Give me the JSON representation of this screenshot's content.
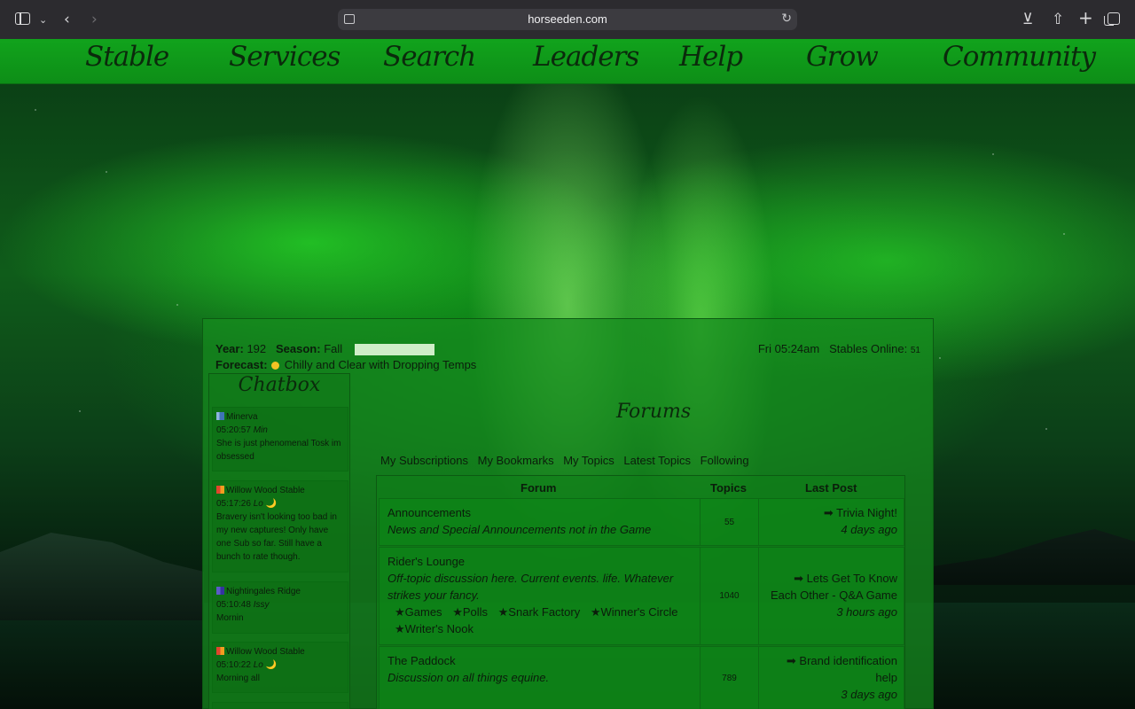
{
  "browser": {
    "url": "horseeden.com",
    "icons": [
      "sidebar-icon",
      "chevron-down-icon",
      "back-icon",
      "forward-icon",
      "page-icon",
      "reload-icon",
      "download-icon",
      "share-icon",
      "new-tab-icon",
      "tabs-icon"
    ]
  },
  "nav": {
    "items": [
      "Stable",
      "Services",
      "Search",
      "Leaders",
      "Help",
      "Grow",
      "Community"
    ]
  },
  "info": {
    "year_label": "Year:",
    "year": "192",
    "season_label": "Season:",
    "season": "Fall",
    "forecast_label": "Forecast:",
    "forecast": "Chilly and Clear with Dropping Temps",
    "time": "Fri 05:24am",
    "online_label": "Stables Online:",
    "online_count": "51"
  },
  "chatbox": {
    "title": "Chatbox",
    "messages": [
      {
        "stable": "Minerva",
        "flag": "blue",
        "time": "05:20:57",
        "user": "Min",
        "moon": "",
        "text": "She is just phenomenal Tosk im obsessed"
      },
      {
        "stable": "Willow Wood Stable",
        "flag": "red",
        "time": "05:17:26",
        "user": "Lo",
        "moon": "🌙",
        "text": "Bravery isn't looking too bad in my new captures! Only have one Sub so far. Still have a bunch to rate though."
      },
      {
        "stable": "Nightingales Ridge",
        "flag": "purple",
        "time": "05:10:48",
        "user": "Issy",
        "moon": "",
        "text": "Mornin"
      },
      {
        "stable": "Willow Wood Stable",
        "flag": "red",
        "time": "05:10:22",
        "user": "Lo",
        "moon": "🌙",
        "text": "Morning all"
      }
    ]
  },
  "forums": {
    "title": "Forums",
    "links": [
      "My Subscriptions",
      "My Bookmarks",
      "My Topics",
      "Latest Topics",
      "Following"
    ],
    "headers": {
      "forum": "Forum",
      "topics": "Topics",
      "last_post": "Last Post"
    },
    "rows": [
      {
        "name": "Announcements",
        "desc": "News and Special Announcements not in the Game",
        "topics": "55",
        "last_arrow": "➡",
        "last_title": "Trivia Night!",
        "last_ago": "4 days ago"
      },
      {
        "name": "Rider's Lounge",
        "desc": "Off-topic discussion here. Current events. life. Whatever strikes your fancy.",
        "subforums": [
          "★Games",
          "★Polls",
          "★Snark Factory",
          "★Winner's Circle",
          "★Writer's Nook"
        ],
        "topics": "1040",
        "last_arrow": "➡",
        "last_title": "Lets Get To Know Each Other - Q&A Game",
        "last_ago": "3 hours ago"
      },
      {
        "name": "The Paddock",
        "desc": "Discussion on all things equine.",
        "topics": "789",
        "last_arrow": "➡",
        "last_title": "Brand identification help",
        "last_ago": "3 days ago"
      }
    ]
  }
}
